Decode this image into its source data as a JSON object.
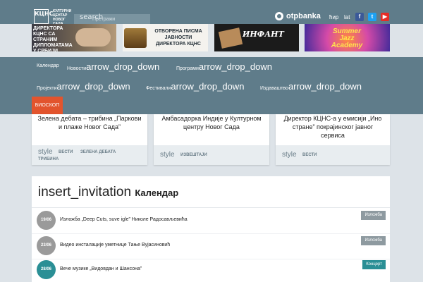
{
  "header": {
    "logo_letters": "КЦНС",
    "logo_text": "КУЛТУРНИ ЦЕНТАР НОВОГ САДА",
    "search": {
      "icon_text": "search",
      "placeholder": "Претражи"
    },
    "sponsor": "otpbanka",
    "languages": [
      "ћир",
      "lat"
    ],
    "social": [
      {
        "icon": "facebook-icon",
        "glyph": "f",
        "color": "#3b5998"
      },
      {
        "icon": "twitter-icon",
        "glyph": "t",
        "color": "#1da1f2"
      },
      {
        "icon": "youtube-icon",
        "glyph": "▶",
        "color": "#e52d27"
      }
    ]
  },
  "banners": [
    {
      "text": "ДИРЕКТОРА КЦНС СА СТРАНИМ ДИПЛОМАТАМА У СРБИЈИ"
    },
    {
      "text": "ОТВОРЕНА ПИСМА ЈАВНОСТИ ДИРЕКТОРА КЦНС"
    },
    {
      "text": "ИНФАНТ"
    },
    {
      "text": "Summer Jazz Academy"
    }
  ],
  "nav": {
    "dropdown_icon": "arrow_drop_down",
    "items": [
      {
        "label": "Календар",
        "dropdown": false
      },
      {
        "label": "Новости",
        "dropdown": true
      },
      {
        "label": "Програми",
        "dropdown": true
      },
      {
        "label": "Пројекти",
        "dropdown": true
      },
      {
        "label": "Фестивали",
        "dropdown": true
      },
      {
        "label": "Издаваштво",
        "dropdown": true
      }
    ],
    "active": "БИОСКОП"
  },
  "cards": [
    {
      "title": "Зелена дебата – трибина „Паркови и плаже Новог Сада”",
      "style_icon": "style",
      "tags": [
        "ВЕСТИ",
        "ЗЕЛЕНА ДЕБАТА",
        "ТРИБИНА"
      ]
    },
    {
      "title": "Амбасадорка Индије у Културном центру Новог Сада",
      "style_icon": "style",
      "tags": [
        "ИЗВЕШТАЈИ"
      ]
    },
    {
      "title": "Директор КЦНС-а у емисији „Ино стране” покрајинског јавног сервиса",
      "style_icon": "style",
      "tags": [
        "ВЕСТИ"
      ]
    }
  ],
  "calendar": {
    "icon_text": "insert_invitation",
    "title": "Календар",
    "events": [
      {
        "date": "19/06",
        "title": "Изложба „Deep Cuts, suve igle” Николе Радосављевића",
        "category": "Изложба"
      },
      {
        "date": "23/06",
        "title": "Видео инсталације уметнице Тање Вујасиновић",
        "category": "Изложба"
      },
      {
        "date": "28/06",
        "title": "Вече музике „Видовдан и Шансона”",
        "category": "Концерт"
      }
    ]
  }
}
